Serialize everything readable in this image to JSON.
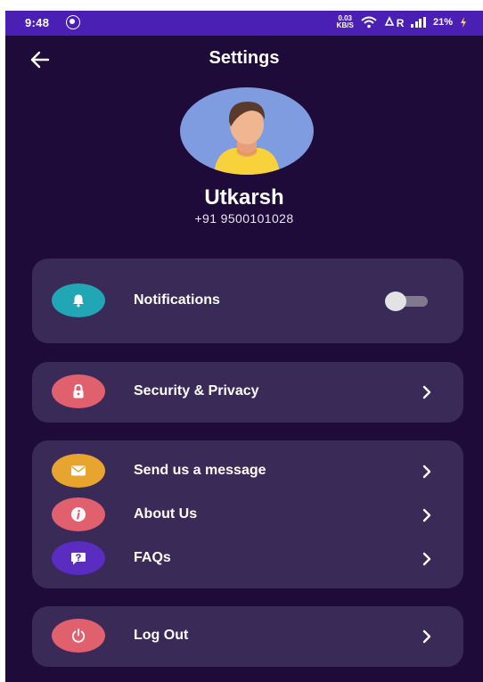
{
  "status_bar": {
    "time": "9:48",
    "speed_value": "0.03",
    "speed_unit": "KB/S",
    "network_label": "R",
    "battery": "21%",
    "bar_color": "#4a1fb3"
  },
  "header": {
    "title": "Settings",
    "back_icon": "arrow-left-icon"
  },
  "profile": {
    "name": "Utkarsh",
    "phone": "+91 9500101028",
    "avatar_icon": "user-avatar-illustration"
  },
  "notifications": {
    "label": "Notifications",
    "icon": "bell-icon",
    "icon_color": "#20a6b4",
    "enabled": false
  },
  "security": {
    "label": "Security & Privacy",
    "icon": "lock-icon",
    "icon_color": "#e0606e"
  },
  "support": {
    "items": [
      {
        "label": "Send us a message",
        "icon": "envelope-icon",
        "icon_color": "#e7a52f"
      },
      {
        "label": "About Us",
        "icon": "info-icon",
        "icon_color": "#e0606e"
      },
      {
        "label": "FAQs",
        "icon": "question-chat-icon",
        "icon_color": "#5a2cc0"
      }
    ]
  },
  "logout": {
    "label": "Log Out",
    "icon": "power-icon",
    "icon_color": "#e0606e"
  },
  "theme": {
    "background": "#1e0b3a",
    "card": "#3a2a58"
  }
}
